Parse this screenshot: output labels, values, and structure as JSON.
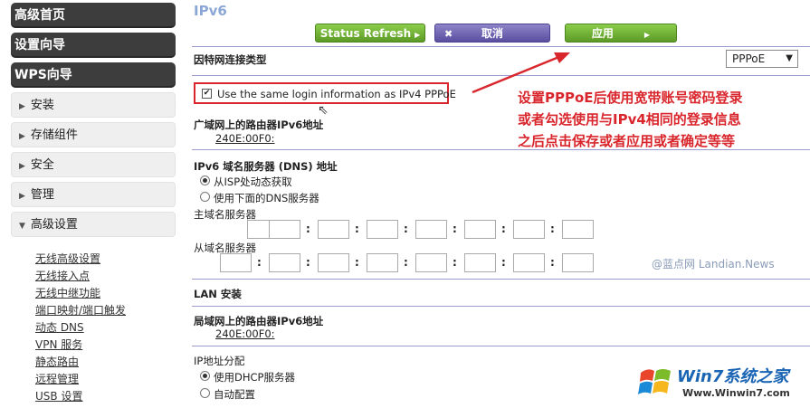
{
  "sidebar": {
    "main_items": [
      "高级首页",
      "设置向导",
      "WPS向导"
    ],
    "sections": [
      "安装",
      "存储组件",
      "安全",
      "管理",
      "高级设置"
    ],
    "sub_items": [
      "无线高级设置",
      "无线接入点",
      "无线中继功能",
      "端口映射/端口触发",
      "动态 DNS",
      "VPN 服务",
      "静态路由",
      "远程管理",
      "USB 设置"
    ]
  },
  "main": {
    "title": "IPv6",
    "buttons": {
      "refresh": "Status Refresh",
      "cancel": "取消",
      "apply": "应用"
    },
    "connection_type_label": "因特网连接类型",
    "connection_type_value": "PPPoE",
    "same_login_label": "Use the same login information as IPv4 PPPoE",
    "wan_ipv6_label": "广域网上的路由器IPv6地址",
    "wan_ipv6_value": "240E:00F0:",
    "dns_section_label": "IPv6 域名服务器 (DNS) 地址",
    "dns_option_auto": "从ISP处动态获取",
    "dns_option_manual": "使用下面的DNS服务器",
    "primary_dns_label": "主域名服务器",
    "secondary_dns_label": "从域名服务器",
    "lan_section_label": "LAN 安装",
    "lan_ipv6_label": "局域网上的路由器IPv6地址",
    "lan_ipv6_value": "240E:00F0:",
    "ip_assign_label": "IP地址分配",
    "ip_assign_dhcp": "使用DHCP服务器",
    "ip_assign_auto": "自动配置"
  },
  "annotation": {
    "lines": [
      "设置PPPoE后使用宽带账号密码登录",
      "或者勾选使用与IPv4相同的登录信息",
      "之后点击保存或者应用或者确定等等"
    ],
    "color": "#d9262c"
  },
  "watermark": "@蓝点网 Landian.News",
  "logo": {
    "text": "Win7系统之家",
    "url": "Www.Winwin7.com"
  },
  "colors": {
    "sidebar_dark": "#3d3d3d",
    "button_green": "#6aaa30",
    "button_purple": "#6a5fb0",
    "title": "#8aa7d6",
    "divider": "#9b9bd0"
  }
}
